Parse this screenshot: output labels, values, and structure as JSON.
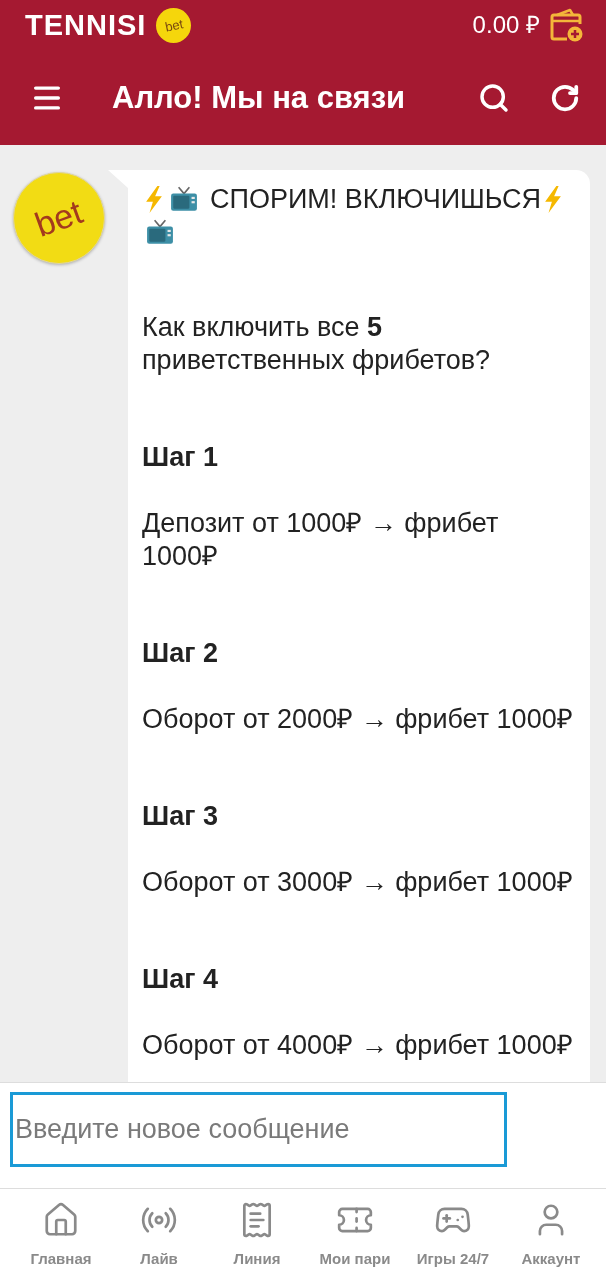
{
  "app_bar": {
    "logo": "TENNISI",
    "logo_badge": "bet",
    "balance": "0.00 ₽"
  },
  "toolbar": {
    "title": "Алло! Мы на связи"
  },
  "chat": {
    "avatar_label": "bet",
    "message": {
      "headline": "СПОРИМ! ВКЛЮЧИШЬСЯ",
      "question": "Как включить все **5** приветственных фрибетов?",
      "steps": [
        {
          "heading": "Шаг 1",
          "text": "Депозит от 1000₽ → фрибет 1000₽"
        },
        {
          "heading": "Шаг 2",
          "text": "Оборот от 2000₽ → фрибет 1000₽"
        },
        {
          "heading": "Шаг 3",
          "text": "Оборот от 3000₽ → фрибет 1000₽"
        },
        {
          "heading": "Шаг 4",
          "text": "Оборот от 4000₽ → фрибет 1000₽"
        }
      ]
    }
  },
  "composer": {
    "placeholder": "Введите новое сообщение"
  },
  "bottom_nav": {
    "items": [
      {
        "label": "Главная",
        "selected": false
      },
      {
        "label": "Лайв",
        "selected": false
      },
      {
        "label": "Линия",
        "selected": false
      },
      {
        "label": "Мои пари",
        "selected": false
      },
      {
        "label": "Игры 24/7",
        "selected": false
      },
      {
        "label": "Аккаунт",
        "selected": false
      }
    ]
  }
}
